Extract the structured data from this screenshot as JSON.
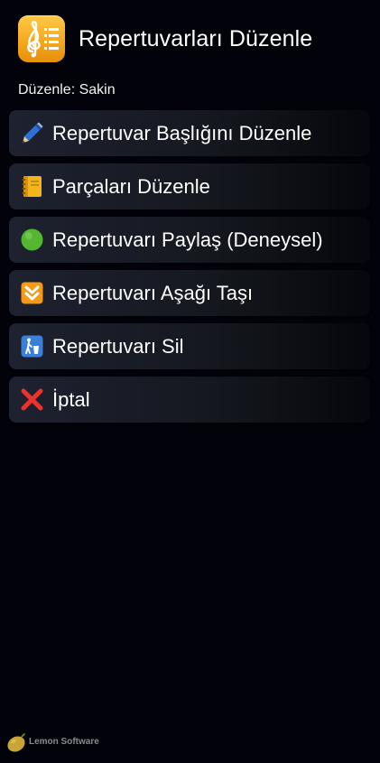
{
  "header": {
    "title": "Repertuvarları Düzenle",
    "app_icon": "music-list-icon"
  },
  "subtitle": "Düzenle: Sakin",
  "menu": {
    "items": [
      {
        "icon": "pencil-icon",
        "label": "Repertuvar Başlığını Düzenle"
      },
      {
        "icon": "notebook-icon",
        "label": "Parçaları Düzenle"
      },
      {
        "icon": "green-circle-icon",
        "label": "Repertuvarı Paylaş (Deneysel)"
      },
      {
        "icon": "down-arrow-icon",
        "label": "Repertuvarı Aşağı Taşı"
      },
      {
        "icon": "litter-bin-icon",
        "label": "Repertuvarı Sil"
      },
      {
        "icon": "cross-mark-icon",
        "label": "İptal"
      }
    ]
  },
  "footer": {
    "brand": "Lemon Software"
  },
  "colors": {
    "background": "#02030a",
    "item_background": "#1e2230",
    "app_icon_orange": "#f5a81e"
  }
}
